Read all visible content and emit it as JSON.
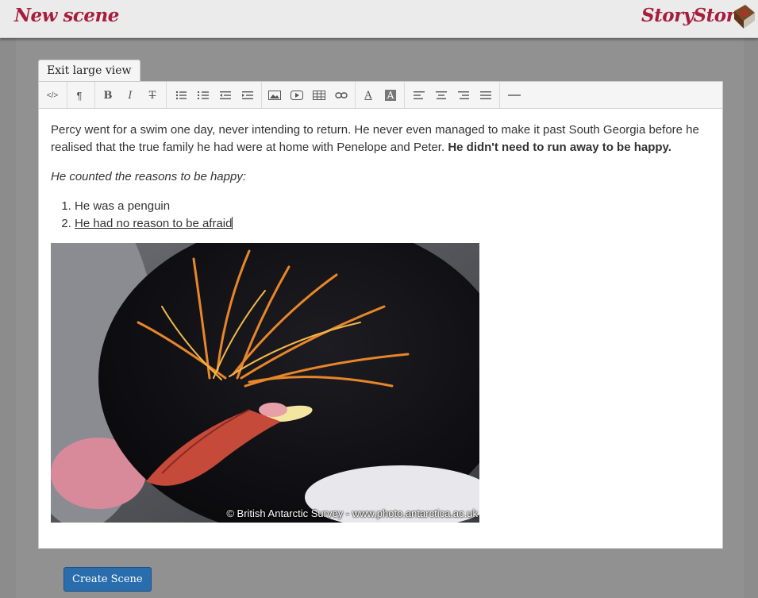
{
  "header": {
    "page_title": "New scene",
    "brand": "StoryStore",
    "brand_logo_icon": "book-logo-icon"
  },
  "editor": {
    "exit_button": "Exit large view",
    "toolbar": [
      {
        "name": "html-icon",
        "label": "</>"
      },
      {
        "name": "paragraph-icon",
        "label": "¶"
      },
      {
        "name": "bold-icon",
        "label": "B"
      },
      {
        "name": "italic-icon",
        "label": "I"
      },
      {
        "name": "strikethrough-icon",
        "label": "T"
      },
      {
        "name": "unordered-list-icon",
        "label": "☰"
      },
      {
        "name": "ordered-list-icon",
        "label": "☰"
      },
      {
        "name": "outdent-icon",
        "label": "⇤"
      },
      {
        "name": "indent-icon",
        "label": "⇥"
      },
      {
        "name": "image-icon",
        "label": "▣"
      },
      {
        "name": "video-icon",
        "label": "▶"
      },
      {
        "name": "table-icon",
        "label": "▦"
      },
      {
        "name": "link-icon",
        "label": "∞"
      },
      {
        "name": "font-color-icon",
        "label": "A"
      },
      {
        "name": "background-color-icon",
        "label": "A"
      },
      {
        "name": "align-left-icon",
        "label": "≡"
      },
      {
        "name": "align-center-icon",
        "label": "≡"
      },
      {
        "name": "align-right-icon",
        "label": "≡"
      },
      {
        "name": "justify-icon",
        "label": "≡"
      },
      {
        "name": "horizontal-rule-icon",
        "label": "—"
      }
    ],
    "paragraph1_plain": "Percy went for a swim one day, never intending to return. He never even managed to make it past South Georgia before he realised that the true family he had were at home with Penelope and Peter. ",
    "paragraph1_bold": "He didn't need to run away to be happy.",
    "paragraph2_italic": "He counted the reasons to be happy:",
    "list": [
      "He was a penguin",
      "He had no reason to be afraid"
    ],
    "image_credit": "© British Antarctic Survey - www.photo.antarctica.ac.uk"
  },
  "footer": {
    "create_button": "Create Scene"
  },
  "colors": {
    "brand": "#a51e3c",
    "primary_button": "#2a6dac",
    "backdrop": "#8c8c8c"
  }
}
